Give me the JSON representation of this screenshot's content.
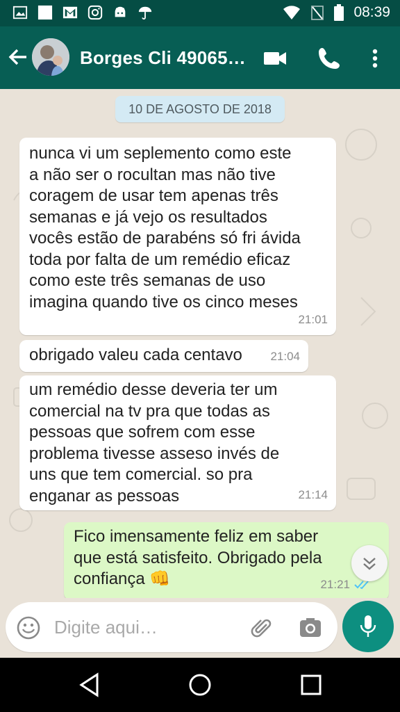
{
  "status_bar": {
    "time": "08:39"
  },
  "header": {
    "contact_name": "Borges Cli 49065…"
  },
  "chat": {
    "date_label": "10 DE AGOSTO DE 2018",
    "messages": [
      {
        "direction": "incoming",
        "text": "nunca vi um seplemento como este\na não ser o rocultan mas não tive\ncoragem de usar tem apenas três\nsemanas e já vejo os resultados\nvocês estão de parabéns só fri ávida\ntoda por falta de um remédio eficaz\ncomo este três semanas de uso\nimagina quando  tive os cinco meses",
        "time": "21:01"
      },
      {
        "direction": "incoming",
        "text": "obrigado valeu cada centavo",
        "time": "21:04"
      },
      {
        "direction": "incoming",
        "text": "um remédio desse deveria ter um\ncomercial na tv pra que todas as\npessoas que sofrem com esse\nproblema tivesse asseso invés de\nuns que tem comercial.    so pra\nenganar as pessoas",
        "time": "21:14"
      },
      {
        "direction": "outgoing",
        "text": "Fico imensamente feliz em saber\nque está satisfeito. Obrigado pela\nconfiança 👊",
        "time": "21:21",
        "status": "read"
      }
    ]
  },
  "composer": {
    "placeholder": "Digite aqui…"
  },
  "colors": {
    "header": "#075e54",
    "status_bar": "#054d44",
    "outgoing_bubble": "#dcf8c6",
    "mic_button": "#0d8f80",
    "read_ticks": "#4fc3f7"
  }
}
